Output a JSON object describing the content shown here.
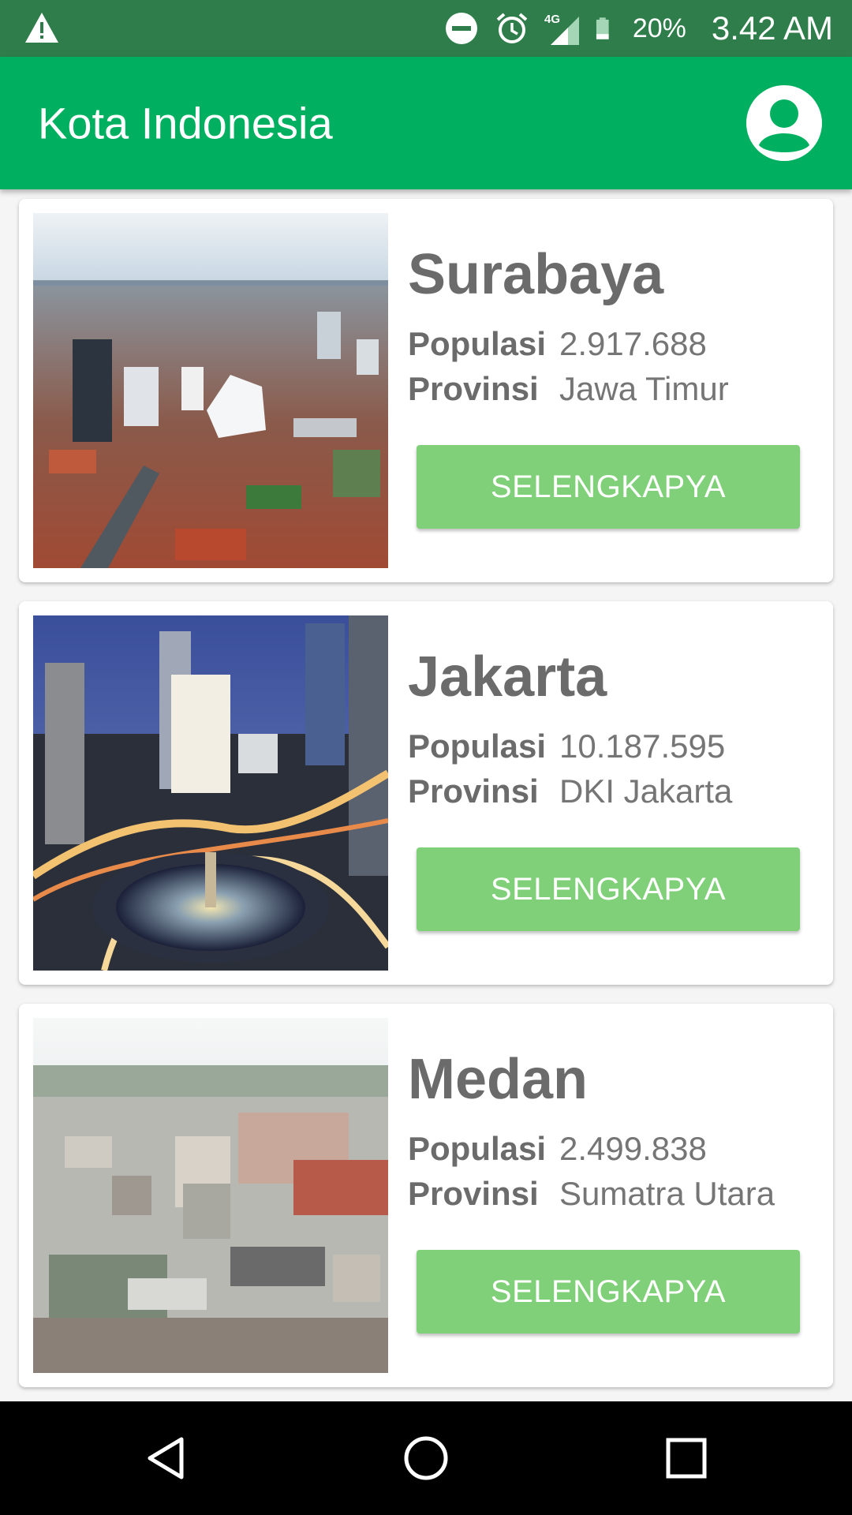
{
  "status_bar": {
    "icons": [
      "warning-icon",
      "do-not-disturb-icon",
      "alarm-icon",
      "signal-4g-icon",
      "battery-icon"
    ],
    "network_label": "4G",
    "battery_percent": "20%",
    "time": "3.42 AM",
    "color": "#2e7d4a"
  },
  "app_bar": {
    "title": "Kota Indonesia",
    "profile_icon": "account-circle-icon",
    "color": "#00b060"
  },
  "cities": [
    {
      "name": "Surabaya",
      "population_label": "Populasi",
      "population": "2.917.688",
      "province_label": "Provinsi",
      "province": "Jawa Timur",
      "button_label": "SELENGKAPYA",
      "image": "city-aerial-photo"
    },
    {
      "name": "Jakarta",
      "population_label": "Populasi",
      "population": "10.187.595",
      "province_label": "Provinsi",
      "province": "DKI Jakarta",
      "button_label": "SELENGKAPYA",
      "image": "city-night-roundabout-photo"
    },
    {
      "name": "Medan",
      "population_label": "Populasi",
      "population": "2.499.838",
      "province_label": "Provinsi",
      "province": "Sumatra Utara",
      "button_label": "SELENGKAPYA",
      "image": "city-hazy-skyline-photo"
    }
  ],
  "colors": {
    "button": "#80d07a",
    "text": "#6b6b6b"
  },
  "nav_bar": {
    "icons": [
      "back-icon",
      "home-icon",
      "recents-icon"
    ]
  }
}
